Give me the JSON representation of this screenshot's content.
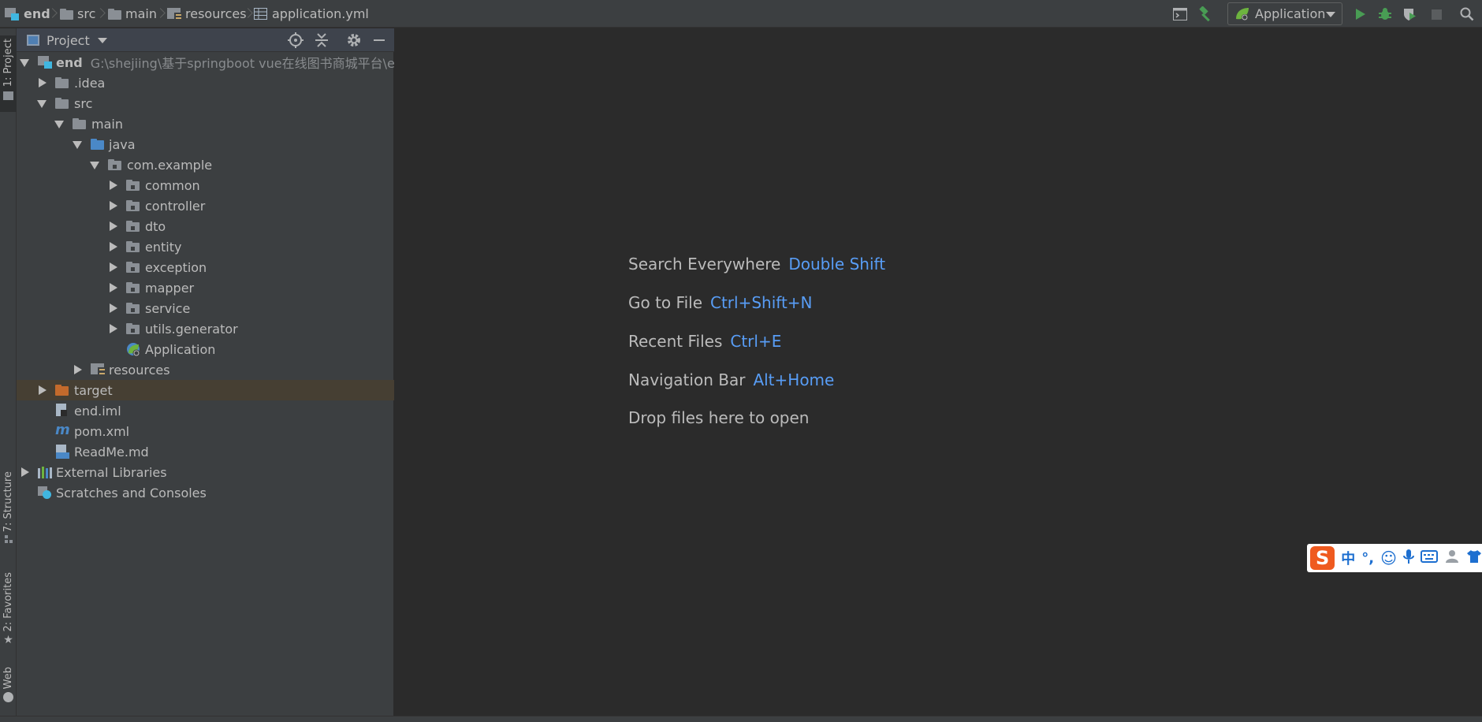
{
  "breadcrumb": {
    "items": [
      {
        "label": "end",
        "bold": true,
        "icon": "module-icon"
      },
      {
        "label": "src",
        "icon": "folder-icon"
      },
      {
        "label": "main",
        "icon": "folder-icon"
      },
      {
        "label": "resources",
        "icon": "resources-folder-icon"
      },
      {
        "label": "application.yml",
        "icon": "yml-file-icon"
      }
    ]
  },
  "toolbar": {
    "run_config_label": "Application",
    "colors": {
      "run": "#499c54",
      "build": "#499c54",
      "debug": "#499c54"
    }
  },
  "left_strip": {
    "tabs": [
      {
        "label": "1: Project",
        "active": true
      },
      {
        "label": "7: Structure"
      },
      {
        "label": "2: Favorites"
      },
      {
        "label": "Web"
      }
    ]
  },
  "project_panel": {
    "title": "Project",
    "tree": [
      {
        "label": "end",
        "bold": true,
        "path": "G:\\shejiing\\基于springboot vue在线图书商城平台\\end",
        "expanded": true,
        "icon": "module-icon"
      },
      {
        "label": ".idea",
        "expanded": false,
        "icon": "folder-icon"
      },
      {
        "label": "src",
        "expanded": true,
        "icon": "folder-icon"
      },
      {
        "label": "main",
        "expanded": true,
        "icon": "folder-icon"
      },
      {
        "label": "java",
        "expanded": true,
        "icon": "source-folder-icon"
      },
      {
        "label": "com.example",
        "expanded": true,
        "icon": "package-icon"
      },
      {
        "label": "common",
        "expanded": false,
        "icon": "package-icon"
      },
      {
        "label": "controller",
        "expanded": false,
        "icon": "package-icon"
      },
      {
        "label": "dto",
        "expanded": false,
        "icon": "package-icon"
      },
      {
        "label": "entity",
        "expanded": false,
        "icon": "package-icon"
      },
      {
        "label": "exception",
        "expanded": false,
        "icon": "package-icon"
      },
      {
        "label": "mapper",
        "expanded": false,
        "icon": "package-icon"
      },
      {
        "label": "service",
        "expanded": false,
        "icon": "package-icon"
      },
      {
        "label": "utils.generator",
        "expanded": false,
        "icon": "package-icon"
      },
      {
        "label": "Application",
        "icon": "spring-boot-class-icon"
      },
      {
        "label": "resources",
        "expanded": false,
        "icon": "resources-folder-icon"
      },
      {
        "label": "target",
        "expanded": false,
        "icon": "excluded-folder-icon",
        "highlighted": true
      },
      {
        "label": "end.iml",
        "icon": "iml-file-icon"
      },
      {
        "label": "pom.xml",
        "icon": "maven-file-icon"
      },
      {
        "label": "ReadMe.md",
        "icon": "markdown-file-icon"
      },
      {
        "label": "External Libraries",
        "expanded": false,
        "icon": "libraries-icon"
      },
      {
        "label": "Scratches and Consoles",
        "icon": "scratches-icon"
      }
    ]
  },
  "editor_hints": [
    {
      "label": "Search Everywhere",
      "shortcut": "Double Shift"
    },
    {
      "label": "Go to File",
      "shortcut": "Ctrl+Shift+N"
    },
    {
      "label": "Recent Files",
      "shortcut": "Ctrl+E"
    },
    {
      "label": "Navigation Bar",
      "shortcut": "Alt+Home"
    },
    {
      "label": "Drop files here to open",
      "shortcut": ""
    }
  ],
  "ime_bar": {
    "logo": "S",
    "mode": "中",
    "punct": "°,",
    "colors": {
      "logo": "#ef5a1f",
      "icons": "#1d6fd0"
    }
  }
}
